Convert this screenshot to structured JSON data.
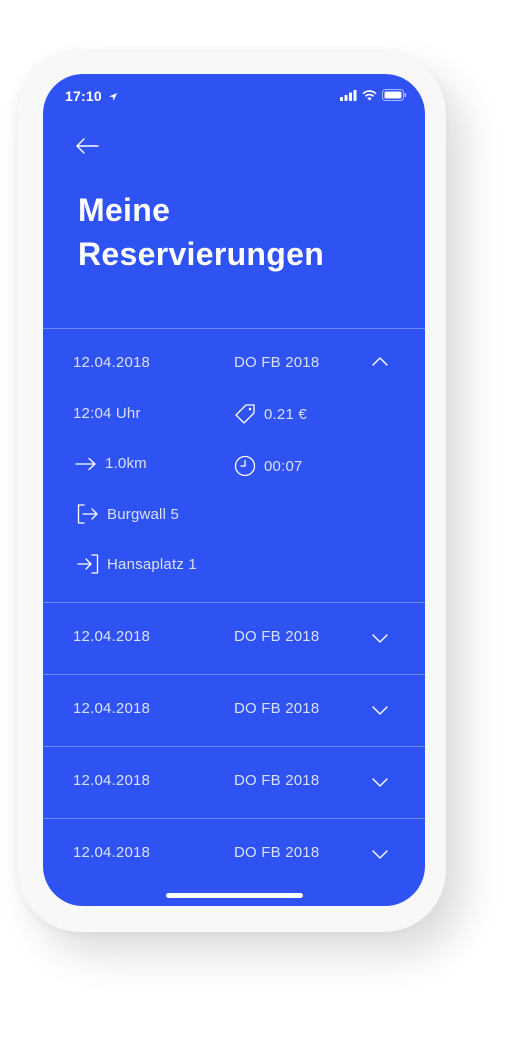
{
  "status_bar": {
    "time": "17:10",
    "icons": [
      "location-arrow-icon",
      "signal-icon",
      "wifi-icon",
      "battery-icon"
    ]
  },
  "header": {
    "back_icon": "arrow-left-icon",
    "title_line1": "Meine",
    "title_line2": "Reservierungen"
  },
  "colors": {
    "background": "#2f52f2",
    "text": "#ffffff"
  },
  "reservations": [
    {
      "date": "12.04.2018",
      "code": "DO FB 2018",
      "expanded": true,
      "time": "12:04 Uhr",
      "price": "0.21 €",
      "distance": "1.0km",
      "duration": "00:07",
      "start_address": "Burgwall 5",
      "end_address": "Hansaplatz 1"
    },
    {
      "date": "12.04.2018",
      "code": "DO FB 2018",
      "expanded": false
    },
    {
      "date": "12.04.2018",
      "code": "DO FB 2018",
      "expanded": false
    },
    {
      "date": "12.04.2018",
      "code": "DO FB 2018",
      "expanded": false
    },
    {
      "date": "12.04.2018",
      "code": "DO FB 2018",
      "expanded": false
    }
  ]
}
